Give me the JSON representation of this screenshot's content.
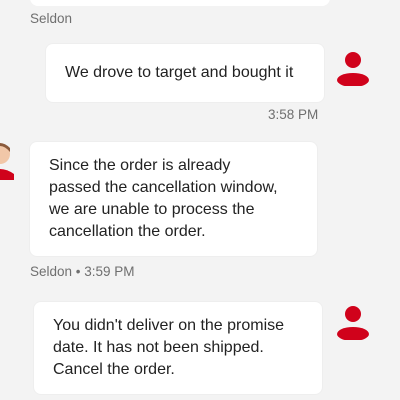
{
  "messages": [
    {
      "sender": "agent",
      "sender_name": "Seldon",
      "text": ""
    },
    {
      "sender": "user",
      "text": "We drove to target and bought it",
      "time": "3:58 PM"
    },
    {
      "sender": "agent",
      "text": "Since  the order is already\npassed the cancellation window,\nwe are unable to process the\ncancellation the order.",
      "meta": "Seldon • 3:59 PM"
    },
    {
      "sender": "user",
      "text": "You didn't deliver on the promise\ndate. It has not been shipped.\nCancel the order."
    }
  ],
  "colors": {
    "background": "#f3f3f3",
    "bubble": "#ffffff",
    "user_avatar": "#d0021b",
    "meta_text": "#6f6f6f"
  },
  "icons": {
    "user_avatar": "person-icon",
    "agent_avatar": "agent-avatar"
  }
}
